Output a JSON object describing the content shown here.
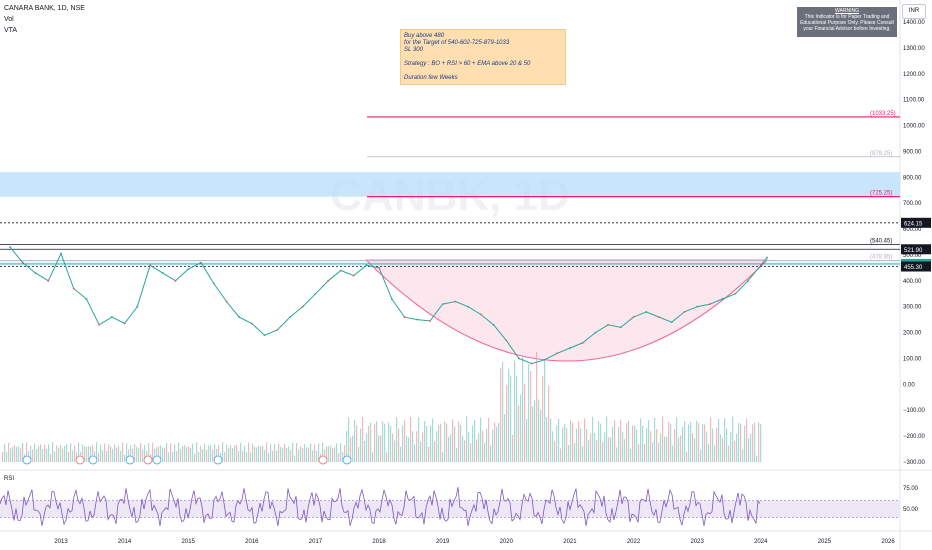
{
  "header": {
    "title": "CANARA BANK, 1D, NSE",
    "ind1": "Vol",
    "ind2": "VTA"
  },
  "currency": "INR",
  "warning": {
    "title": "WARNING",
    "lines": [
      "This Indicator is for Paper Trading and",
      "Educational Purpose Only. Please Consult",
      "your Financial Advisor before Investing."
    ]
  },
  "note": {
    "lines": [
      "Buy above 480",
      "for the Target of 540-602-725-879-1033",
      "SL 300",
      "",
      "Strategy : BO + RSI > 60 + EMA above 20 & 50",
      "",
      "Duration few Weeks"
    ]
  },
  "watermark": "CANBK, 1D",
  "rsi_label": "RSI",
  "chart_data": [
    {
      "type": "line",
      "title": "CANARA BANK, 1D, NSE",
      "xlabel": "",
      "ylabel": "",
      "x_ticks": [
        "2013",
        "2014",
        "2015",
        "2016",
        "2017",
        "2018",
        "2019",
        "2020",
        "2021",
        "2022",
        "2023",
        "2024",
        "2025",
        "2026"
      ],
      "y_ticks": [
        1400,
        1300,
        1200,
        1100,
        1000,
        900,
        800,
        700,
        600,
        500,
        400,
        300,
        200,
        100,
        0,
        -100,
        -200,
        -300
      ],
      "y_tick_labels": [
        "1400.00",
        "1300.00",
        "1200.00",
        "1100.00",
        "1000.00",
        "900.00",
        "800.00",
        "700.00",
        "600.00",
        "500.00",
        "400.00",
        "300.00",
        "200.00",
        "100.00",
        "0.00",
        "−100.00",
        "−200.00",
        "−300.00"
      ],
      "ylim": [
        -310,
        1440
      ],
      "series": [
        {
          "x": [
            2012.2,
            2012.4,
            2012.6,
            2012.8,
            2013.0,
            2013.2,
            2013.4,
            2013.6,
            2013.8,
            2014.0,
            2014.2,
            2014.4,
            2014.6,
            2014.8,
            2015.0,
            2015.2,
            2015.4,
            2015.6,
            2015.8,
            2016.0,
            2016.2,
            2016.4,
            2016.6,
            2016.8,
            2017.0,
            2017.2,
            2017.4,
            2017.6,
            2017.8,
            2018.0,
            2018.2,
            2018.4,
            2018.6,
            2018.8,
            2019.0,
            2019.2,
            2019.4,
            2019.6,
            2019.8,
            2020.0,
            2020.2,
            2020.4,
            2020.6,
            2020.8,
            2021.0,
            2021.2,
            2021.4,
            2021.6,
            2021.8,
            2022.0,
            2022.2,
            2022.4,
            2022.6,
            2022.8,
            2023.0,
            2023.2,
            2023.4,
            2023.6,
            2023.8,
            2024.0,
            2024.1
          ],
          "y": [
            530,
            470,
            430,
            400,
            505,
            370,
            330,
            230,
            260,
            235,
            300,
            460,
            430,
            400,
            445,
            470,
            390,
            320,
            260,
            235,
            190,
            210,
            260,
            300,
            350,
            400,
            440,
            420,
            460,
            450,
            330,
            260,
            250,
            245,
            310,
            320,
            300,
            270,
            230,
            170,
            100,
            80,
            95,
            120,
            140,
            160,
            200,
            230,
            220,
            260,
            280,
            260,
            240,
            280,
            300,
            310,
            330,
            350,
            400,
            460,
            490
          ]
        }
      ],
      "levels": [
        {
          "label": "(1033.25)",
          "value": 1033.25,
          "color": "#e91e63"
        },
        {
          "label": "(879.25)",
          "value": 879.25,
          "color": "#b2b5be"
        },
        {
          "label": "(725.25)",
          "value": 725.25,
          "color": "#e91e63"
        },
        {
          "label": "624.15",
          "value": 624.15,
          "color": "#131722"
        },
        {
          "label": "(540.45)",
          "value": 540.45,
          "color": "#131722"
        },
        {
          "label": "521.90",
          "value": 521.9,
          "color": "#131722"
        },
        {
          "label": "(478.85)",
          "value": 478.85,
          "color": "#b2b5be"
        },
        {
          "label": "465.30",
          "value": 465.3,
          "color": "#26a69a"
        },
        {
          "label": "455.30",
          "value": 455.3,
          "color": "#131722"
        }
      ],
      "zones": [
        {
          "from": 725.25,
          "to": 820,
          "color": "#bbdefb"
        },
        {
          "from": 455.3,
          "to": 478.85,
          "color": "#e3f2fd"
        }
      ],
      "cup": {
        "x_start": 2017.8,
        "x_end": 2024.1,
        "bottom": 90
      }
    },
    {
      "type": "line",
      "title": "RSI",
      "y_ticks": [
        75,
        50
      ],
      "y_tick_labels": [
        "75.00",
        "50.00"
      ],
      "ylim": [
        28,
        90
      ],
      "band": [
        40,
        60
      ]
    }
  ]
}
